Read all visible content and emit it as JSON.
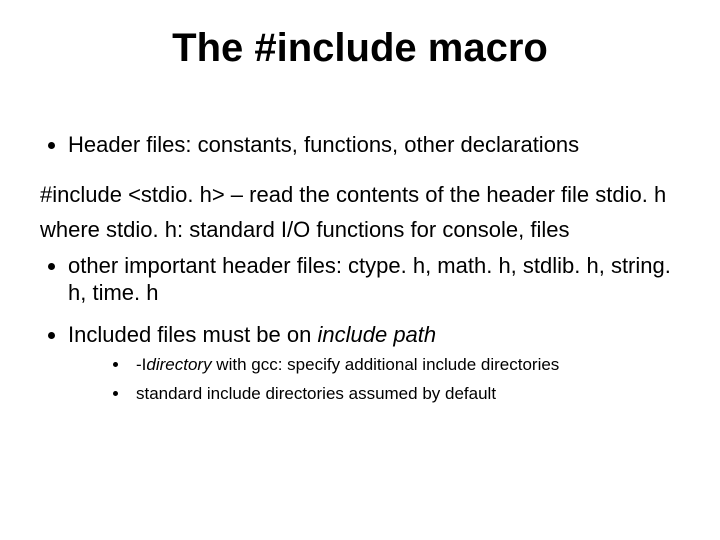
{
  "title": "The #include macro",
  "bullets": {
    "b1": "Header files: constants, functions, other declarations",
    "para1": "#include <stdio. h> – read the contents of the header file stdio. h",
    "para2": "where stdio. h: standard I/O functions for console, files",
    "b2": "other important header files: ctype. h, math. h, stdlib. h, string. h, time. h",
    "b3_prefix": "Included files must be on ",
    "b3_italic": "include path",
    "sub1_prefix": "-I",
    "sub1_italic": "directory",
    "sub1_suffix": " with gcc: specify additional include directories",
    "sub2": "standard include directories assumed by default"
  }
}
